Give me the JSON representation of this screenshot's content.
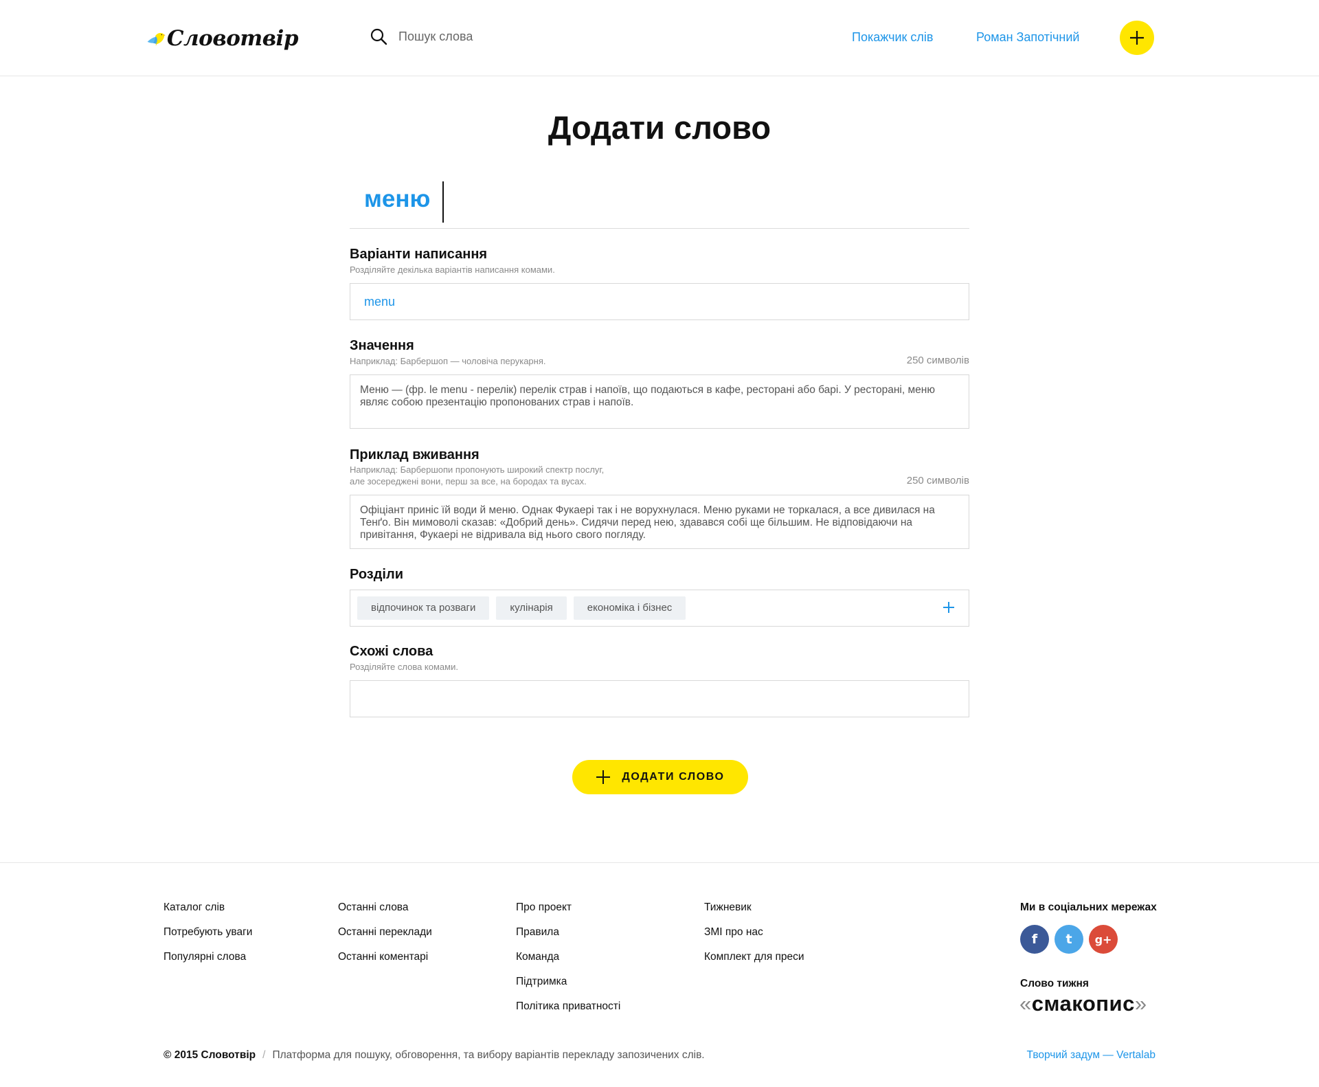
{
  "header": {
    "logo_text": "Словотвір",
    "search_placeholder": "Пошук слова",
    "nav_index": "Покажчик слів",
    "nav_user": "Роман Запотічний"
  },
  "main": {
    "title": "Додати слово",
    "word": "меню",
    "spelling": {
      "label": "Варіанти написання",
      "hint": "Розділяйте декілька варіантів написання комами.",
      "value": "menu"
    },
    "meaning": {
      "label": "Значення",
      "hint": "Наприклад: Барбершоп — чоловіча перукарня.",
      "counter": "250 символів",
      "value": "Меню — (фр. le menu - перелік) перелік страв і напоїв, що подаються в кафе, ресторані або барі. У ресторані, меню являє собою презентацію пропонованих страв і напоїв."
    },
    "example": {
      "label": "Приклад вживання",
      "hint_line1": "Наприклад: Барбершопи пропонують широкий спектр послуг,",
      "hint_line2": "але зосереджені вони, перш за все, на бородах та вусах.",
      "counter": "250 символів",
      "value": "Офіціант приніс їй води й меню. Однак Фукаері так і не ворухнулася. Меню руками не торкалася, а все дивилася на Тенґо. Він мимоволі сказав: «Добрий день». Сидячи перед нею, здавався собі ще більшим. Не відповідаючи на привітання, Фукаері не відривала від нього свого погляду."
    },
    "sections": {
      "label": "Розділи",
      "tags": [
        "відпочинок та розваги",
        "кулінарія",
        "економіка і бізнес"
      ]
    },
    "similar": {
      "label": "Схожі слова",
      "hint": "Розділяйте слова комами.",
      "value": ""
    },
    "submit_label": "ДОДАТИ СЛОВО"
  },
  "footer": {
    "col1": [
      "Каталог слів",
      "Потребують уваги",
      "Популярні слова"
    ],
    "col2": [
      "Останні слова",
      "Останні переклади",
      "Останні коментарі"
    ],
    "col3": [
      "Про проект",
      "Правила",
      "Команда",
      "Підтримка",
      "Політика приватності"
    ],
    "col4": [
      "Тижневик",
      "ЗМІ про нас",
      "Комплект для преси"
    ],
    "social_title": "Ми в соціальних мережах",
    "social": {
      "facebook": "f",
      "twitter": "t",
      "googleplus": "g+"
    },
    "word_of_week_title": "Слово тижня",
    "word_of_week": "смакопис",
    "copyright": "© 2015 Словотвір",
    "tagline": "Платформа для пошуку, обговорення, та вибору варіантів перекладу запозичених слів.",
    "credit": "Творчий задум — Vertalab"
  },
  "colors": {
    "accent_blue": "#1d95e8",
    "accent_yellow": "#ffe600",
    "facebook": "#3b5998",
    "twitter": "#4ba6e8",
    "googleplus": "#db4b39"
  },
  "icons": [
    "bird-logo-icon",
    "search-icon",
    "plus-icon",
    "facebook-icon",
    "twitter-icon",
    "google-plus-icon"
  ]
}
